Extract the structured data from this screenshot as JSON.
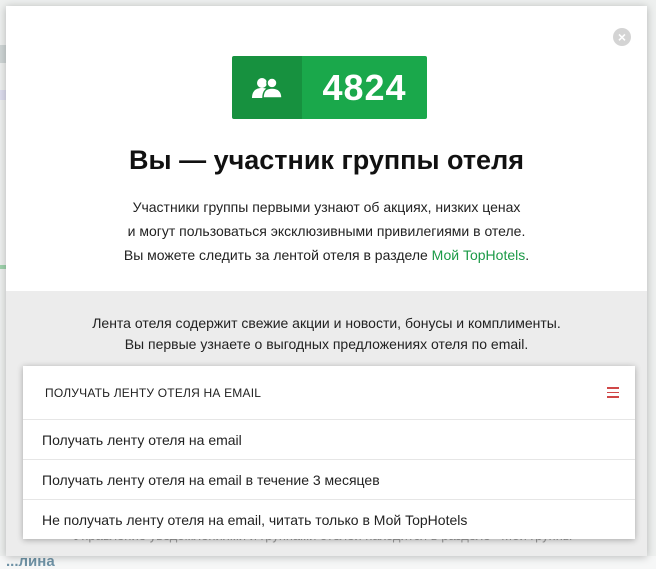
{
  "modal": {
    "close_symbol": "×",
    "member_count": "4824",
    "title": "Вы — участник группы отеля",
    "description": {
      "line1": "Участники группы первыми узнают об акциях, низких ценах",
      "line2": "и могут пользоваться эксклюзивными привилегиями в отеле.",
      "line3_prefix": "Вы можете следить за лентой отеля в разделе ",
      "line3_link": "Мой TopHotels",
      "line3_suffix": "."
    },
    "feed_info": {
      "line1": "Лента отеля содержит свежие акции и новости, бонусы и комплименты.",
      "line2": "Вы первые узнаете о выгодных предложениях отеля по email."
    },
    "footer_partial": "Управление уведомлениями и группами отелей находится в разделе «Мои группы»"
  },
  "dropdown": {
    "header_label": "ПОЛУЧАТЬ ЛЕНТУ ОТЕЛЯ НА EMAIL",
    "options": [
      "Получать ленту отеля на email",
      "Получать ленту отеля на email в течение 3 месяцев",
      "Не получать ленту отеля на email, читать только в Мой TopHotels"
    ]
  },
  "background": {
    "bottom_partial": "...лина"
  },
  "colors": {
    "brand_green": "#1aa84b",
    "brand_green_dark": "#17913f",
    "menu_icon": "#d04848"
  },
  "icons": {
    "group": "group-users-icon",
    "menu": "hamburger-menu-icon",
    "close": "close-icon"
  }
}
